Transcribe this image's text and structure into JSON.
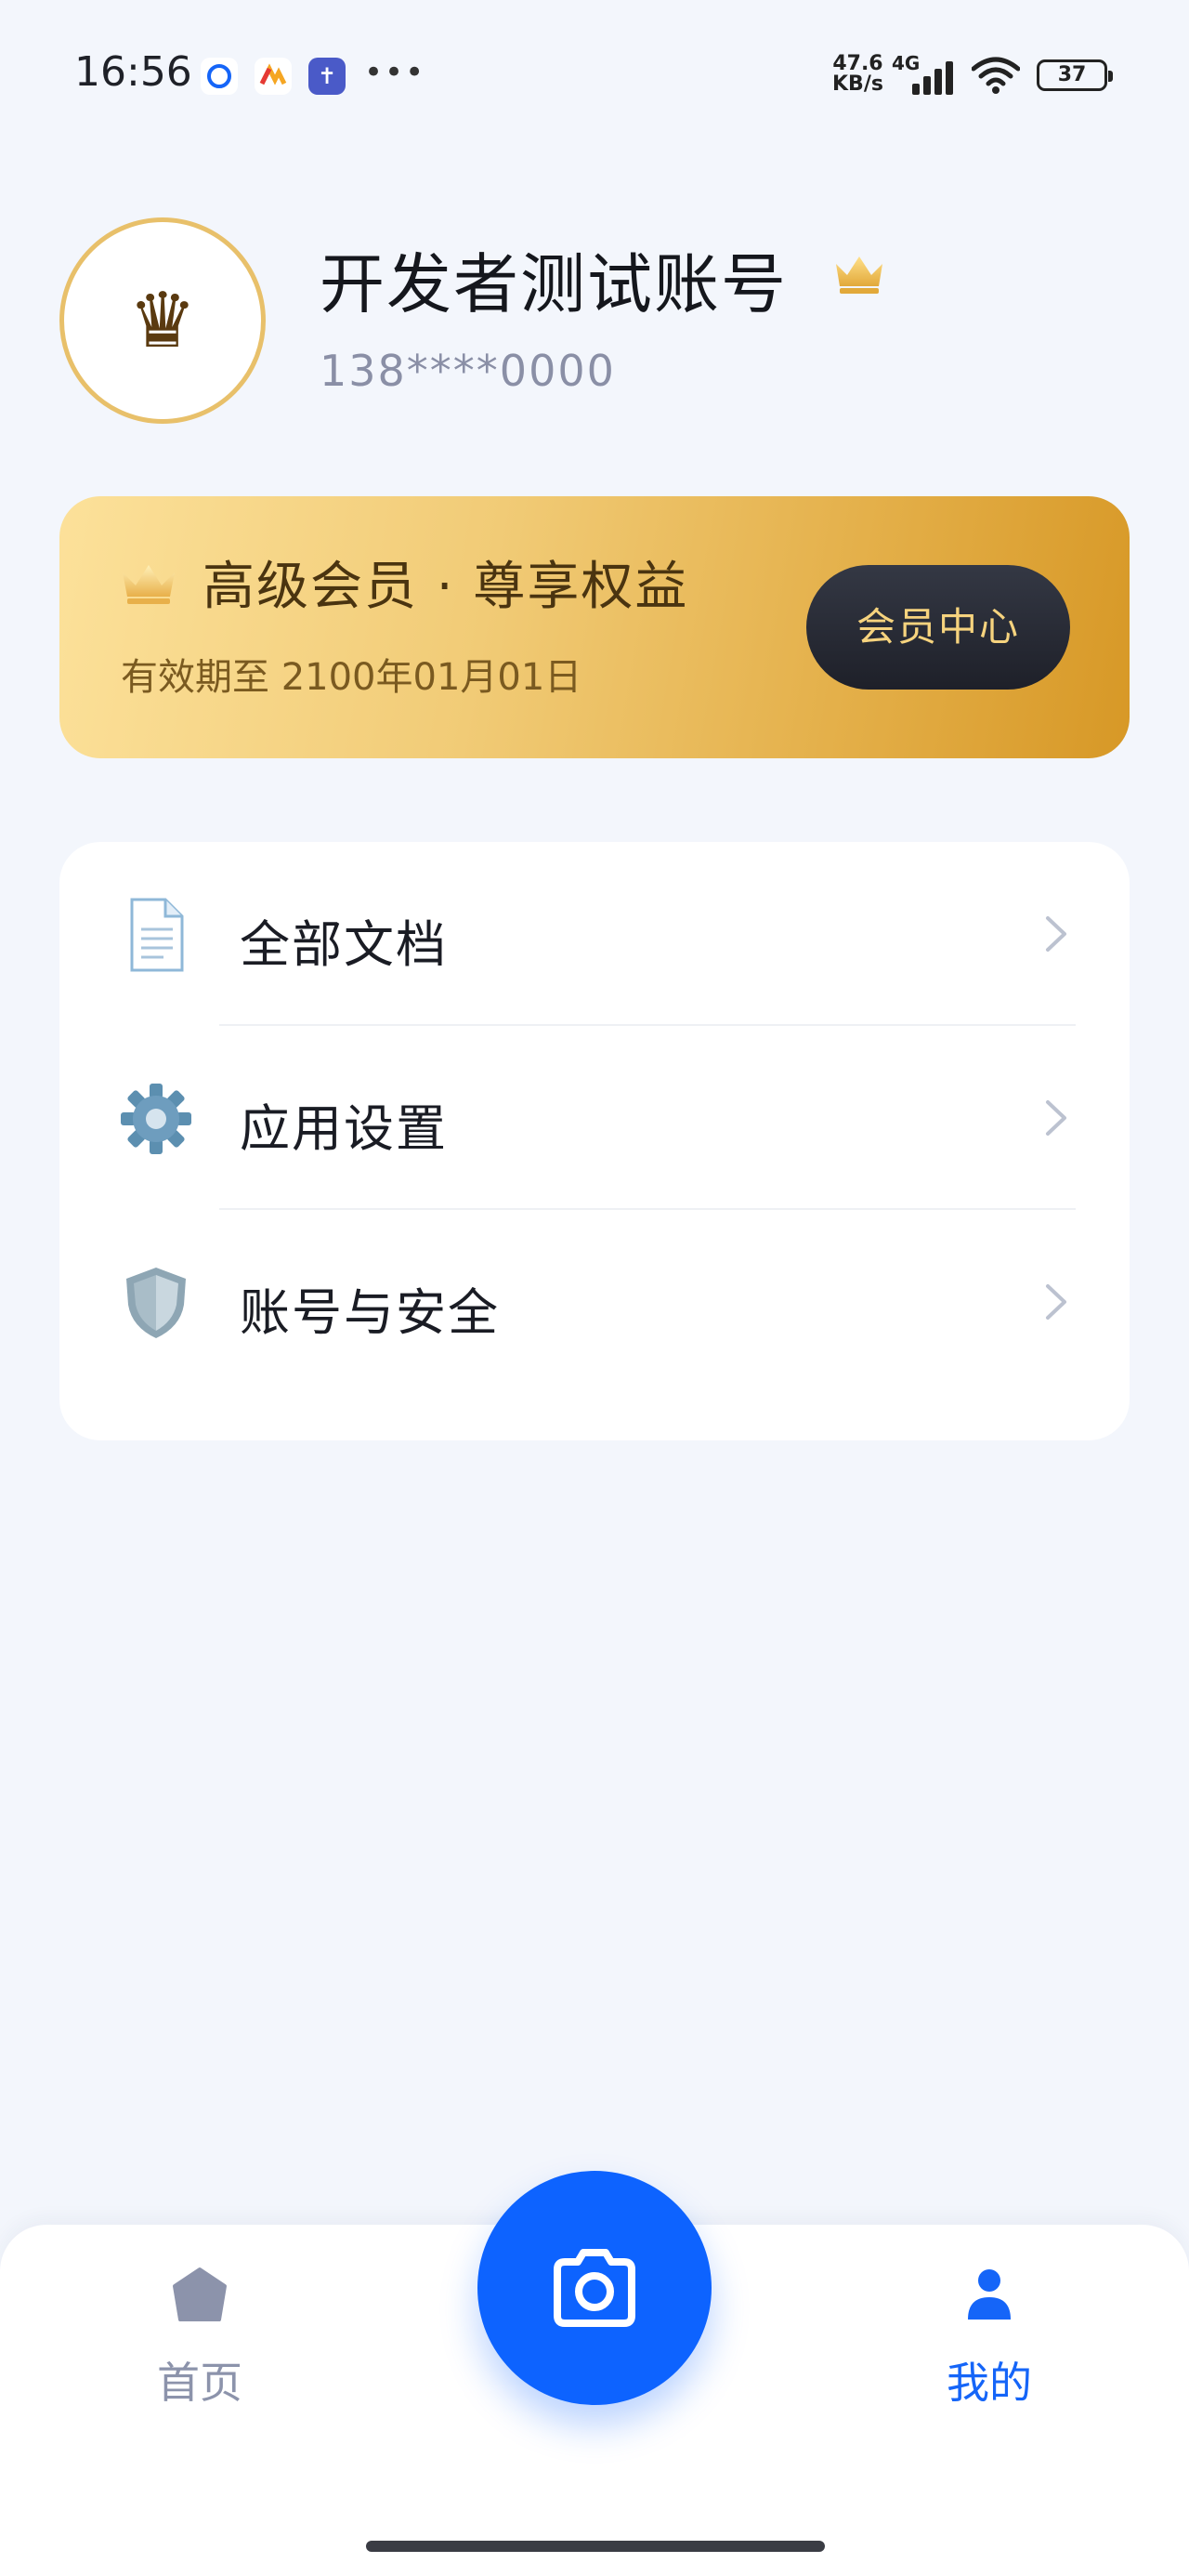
{
  "status_bar": {
    "time": "16:56",
    "net_speed_value": "47.6",
    "net_speed_unit": "KB/s",
    "network_type": "4G",
    "battery_level": "37",
    "battery_fraction": 0.37
  },
  "profile": {
    "username": "开发者测试账号",
    "phone": "138****0000",
    "avatar_icon": "crown-icon"
  },
  "vip": {
    "title": "高级会员 · 尊享权益",
    "expire": "有效期至 2100年01月01日",
    "center_button": "会员中心"
  },
  "menu": {
    "items": [
      {
        "label": "全部文档",
        "icon": "document-icon"
      },
      {
        "label": "应用设置",
        "icon": "gear-icon"
      },
      {
        "label": "账号与安全",
        "icon": "shield-icon"
      }
    ]
  },
  "bottom_nav": {
    "home_label": "首页",
    "mine_label": "我的",
    "active": "mine"
  },
  "colors": {
    "accent": "#0D63FF",
    "gold": "#E3AE47",
    "background": "#F3F6FC"
  }
}
